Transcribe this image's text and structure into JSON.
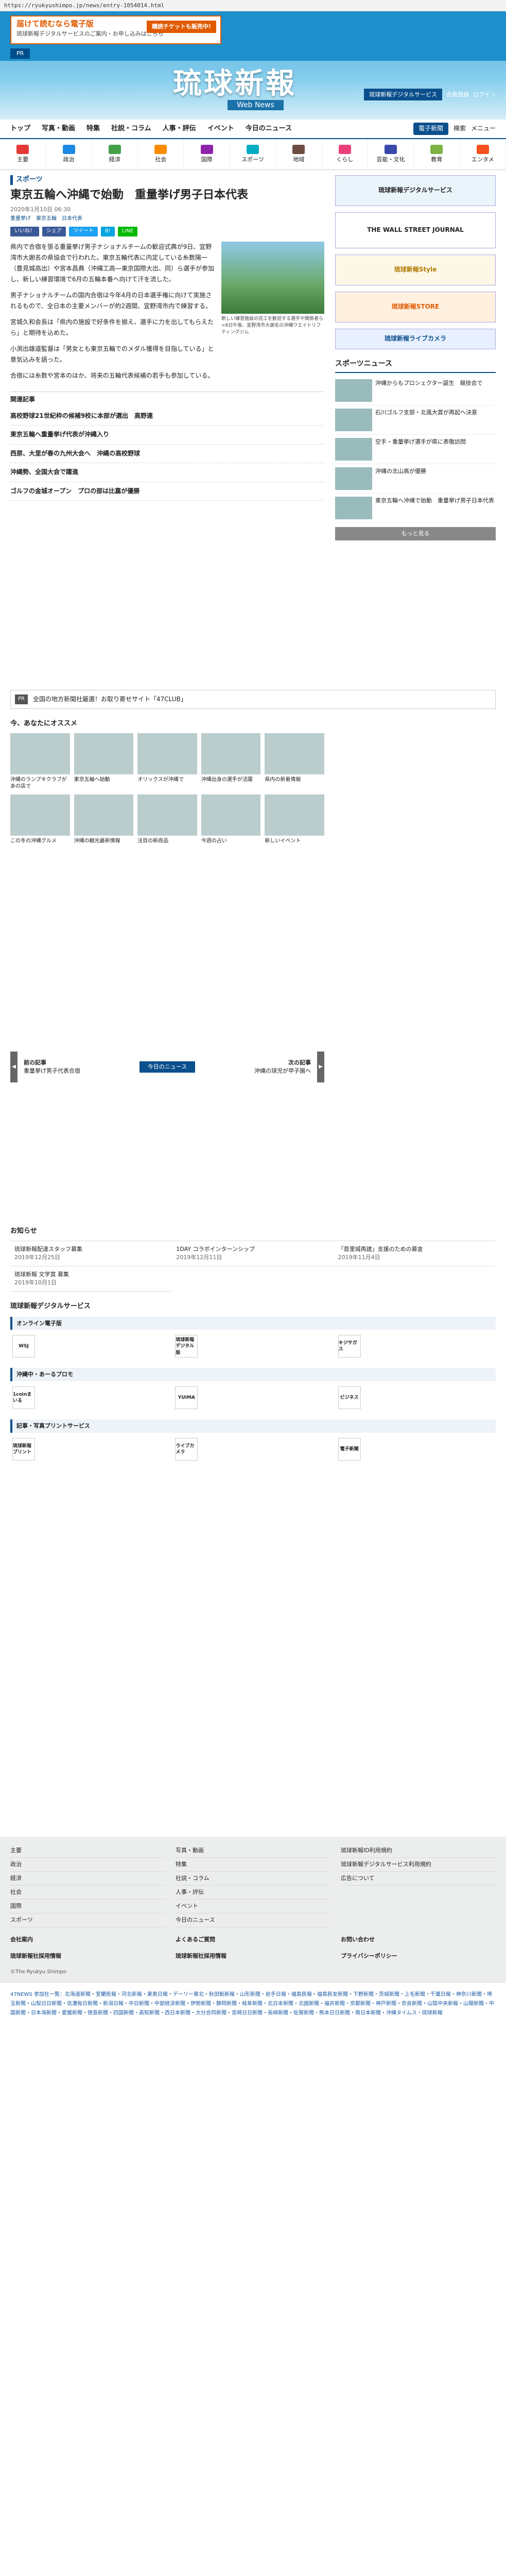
{
  "url": "https://ryukyushimpo.jp/news/entry-1054014.html",
  "header": {
    "banner_title": "届けて読むなら電子版",
    "banner_sub": "琉球新報デジタルサービスのご案内・お申し込みはこちら",
    "banner_cta": "購読チケットも販売中!",
    "pr": "PR",
    "logo": "琉球新報",
    "logo_sub": "Web News",
    "svc_btn": "琉球新報デジタルサービス",
    "register": "会員登録",
    "login": "ログイン"
  },
  "nav": {
    "items": [
      "トップ",
      "写真・動画",
      "特集",
      "社説・コラム",
      "人事・評伝",
      "イベント",
      "今日のニュース"
    ],
    "paper": "電子新聞",
    "search": "検索",
    "menu": "メニュー"
  },
  "cats": [
    {
      "label": "主要",
      "color": "#e53935"
    },
    {
      "label": "政治",
      "color": "#1e88e5"
    },
    {
      "label": "経済",
      "color": "#43a047"
    },
    {
      "label": "社会",
      "color": "#fb8c00"
    },
    {
      "label": "国際",
      "color": "#8e24aa"
    },
    {
      "label": "スポーツ",
      "color": "#00acc1"
    },
    {
      "label": "地域",
      "color": "#6d4c41"
    },
    {
      "label": "くらし",
      "color": "#ec407a"
    },
    {
      "label": "芸能・文化",
      "color": "#3949ab"
    },
    {
      "label": "教育",
      "color": "#7cb342"
    },
    {
      "label": "エンタメ",
      "color": "#f4511e"
    }
  ],
  "article": {
    "kicker": "スポーツ",
    "title": "東京五輪へ沖縄で始動　重量挙げ男子日本代表",
    "date": "2020年1月10日 06:30",
    "tags": "重量挙げ　東京五輪　日本代表",
    "share": [
      "いいね！",
      "シェア",
      "ツイート",
      "B!",
      "LINE"
    ],
    "photo_caption": "新しい練習施設の完工を歓迎する選手や関係者ら=8日午後、宜野湾市大謝名の沖縄ウエイトリフティングジム",
    "paras": [
      "県内で合宿を張る重量挙げ男子ナショナルチームの歓迎式典が9日、宜野湾市大謝名の県協会で行われた。東京五輪代表に内定している糸数陽一（豊見城高出）や宮本昌典（沖縄工高―東京国際大出、同）ら選手が参加し、新しい練習環境で6月の五輪本番へ向けて汗を流した。",
      "男子ナショナルチームの国内合宿は今年4月の日本選手権に向けて実施されるもので、全日本の主要メンバーが約2週間、宜野湾市内で練習する。",
      "宮城久和会長は「県内の施設で好条件を揃え、選手に力を出してもらえたら」と期待を込めた。",
      "小渕出雄道監督は「男女とも東京五輪でのメダル獲得を目指している」と意気込みを語った。",
      "合宿には糸数や宮本のほか、将来の五輪代表候補の若手も参加している。"
    ]
  },
  "related": {
    "heading": "関連記事",
    "items": [
      "高校野球21世紀枠の候補9校に本部が選出　高野連",
      "東京五輪へ重量挙げ代表が沖縄入り",
      "西原、大里が春の九州大会へ　沖縄の高校野球",
      "沖縄勢、全国大会で躍進",
      "ゴルフの金城オープン　プロの部は比嘉が優勝"
    ]
  },
  "side": {
    "ad1": "琉球新報デジタルサービス",
    "ad2": "THE WALL STREET JOURNAL",
    "ad3": "琉球新報Style",
    "ad4": "琉球新報STORE",
    "ad5": "琉球新報ライブカメラ",
    "sports_hd": "スポーツニュース",
    "sports": [
      "沖縄からもプロシェクター誕生　競技会で",
      "石川ゴルフ支部・北風大賞が再起へ決意",
      "空手・重量挙げ選手が県に表敬訪問",
      "沖縄の北山高が優勝",
      "東京五輪へ沖縄で始動　重量挙げ男子日本代表"
    ],
    "more": "もっと見る"
  },
  "pr_row": {
    "badge": "PR",
    "text": "全国の地方新聞社厳選！お取り寄せサイト「47CLUB」"
  },
  "recommend": {
    "heading": "今、あなたにオススメ",
    "items": [
      "沖縄のランプキクラブがあの店で",
      "東京五輪へ始動",
      "オリックスが沖縄で",
      "沖縄出身の選手が活躍",
      "県内の新着情報",
      "この冬の沖縄グルメ",
      "沖縄の観光最新情報",
      "注目の新商品",
      "今週の占い",
      "新しいイベント"
    ]
  },
  "pager": {
    "prev_label": "前の記事",
    "prev": "重量挙げ男子代表合宿",
    "today": "今日のニュース",
    "next_label": "次の記事",
    "next": "沖縄の球児が甲子園へ"
  },
  "notice": {
    "heading": "お知らせ",
    "items": [
      {
        "t": "琉球新報配達スタッフ募集",
        "d": "2019年12月25日"
      },
      {
        "t": "1DAY コラボインターンシップ",
        "d": "2019年12月11日"
      },
      {
        "t": "「首里城再建」支援のための募金",
        "d": "2019年11月4日"
      },
      {
        "t": "琉球新報 文学賞 募集",
        "d": "2019年10月1日"
      }
    ]
  },
  "digital": {
    "heading": "琉球新報デジタルサービス",
    "blocks": [
      {
        "hd": "オンライン電子版",
        "items": [
          "WSJ",
          "琉球新報デジタル版",
          "キジサガス"
        ]
      },
      {
        "hd": "沖縄中・あーるプロモ",
        "items": [
          "1coinまいる",
          "YUIMA",
          "ビジネス"
        ]
      },
      {
        "hd": "記事・写真プリントサービス",
        "items": [
          "琉球新報プリント",
          "ライブカメラ",
          "電子新聞"
        ]
      }
    ]
  },
  "footer": {
    "cols": [
      [
        "主要",
        "政治",
        "経済",
        "社会",
        "国際",
        "スポーツ"
      ],
      [
        "写真・動画",
        "特集",
        "社説・コラム",
        "人事・評伝",
        "イベント",
        "今日のニュース"
      ],
      [
        "琉球新報ID利用規約",
        "琉球新報デジタルサービス利用規約",
        "広告について"
      ]
    ],
    "row1": [
      "会社案内",
      "よくあるご質問",
      "お問い合わせ"
    ],
    "row2": [
      "琉球新報社採用情報",
      "琉球新報社採用情報",
      "プライバシーポリシー"
    ],
    "copy": "©The Ryukyu Shimpo"
  },
  "n47": "47NEWS 参加社一覧：北海道新聞・室蘭民報・河北新報・東奥日報・デーリー東北・秋田魁新報・山形新聞・岩手日報・福島民報・福島民友新聞・下野新聞・茨城新聞・上毛新聞・千葉日報・神奈川新聞・埼玉新聞・山梨日日新聞・信濃毎日新聞・新潟日報・中日新聞・中部経済新聞・伊勢新聞・静岡新聞・岐阜新聞・北日本新聞・北國新聞・福井新聞・京都新聞・神戸新聞・奈良新聞・山陰中央新報・山陽新聞・中国新聞・日本海新聞・愛媛新聞・徳島新聞・四国新聞・高知新聞・西日本新聞・大分合同新聞・宮崎日日新聞・長崎新聞・佐賀新聞・熊本日日新聞・南日本新聞・沖縄タイムス・琉球新報"
}
